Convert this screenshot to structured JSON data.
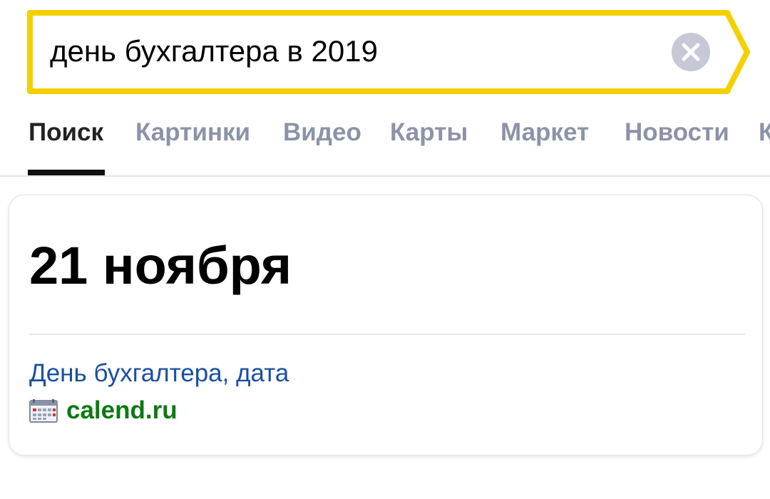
{
  "search": {
    "query": "день бухгалтера в 2019",
    "accent_color": "#f5d000",
    "clear_icon": "close-icon"
  },
  "tabs": [
    {
      "label": "Поиск",
      "active": true
    },
    {
      "label": "Картинки",
      "active": false
    },
    {
      "label": "Видео",
      "active": false
    },
    {
      "label": "Карты",
      "active": false
    },
    {
      "label": "Маркет",
      "active": false
    },
    {
      "label": "Новости",
      "active": false
    },
    {
      "label": "К",
      "active": false
    }
  ],
  "answer_card": {
    "answer": "21 ноября",
    "source_title": "День бухгалтера, дата",
    "source_domain": "calend.ru",
    "source_icon": "calendar-icon",
    "title_color": "#1a4fa0",
    "domain_color": "#0b7a12"
  }
}
